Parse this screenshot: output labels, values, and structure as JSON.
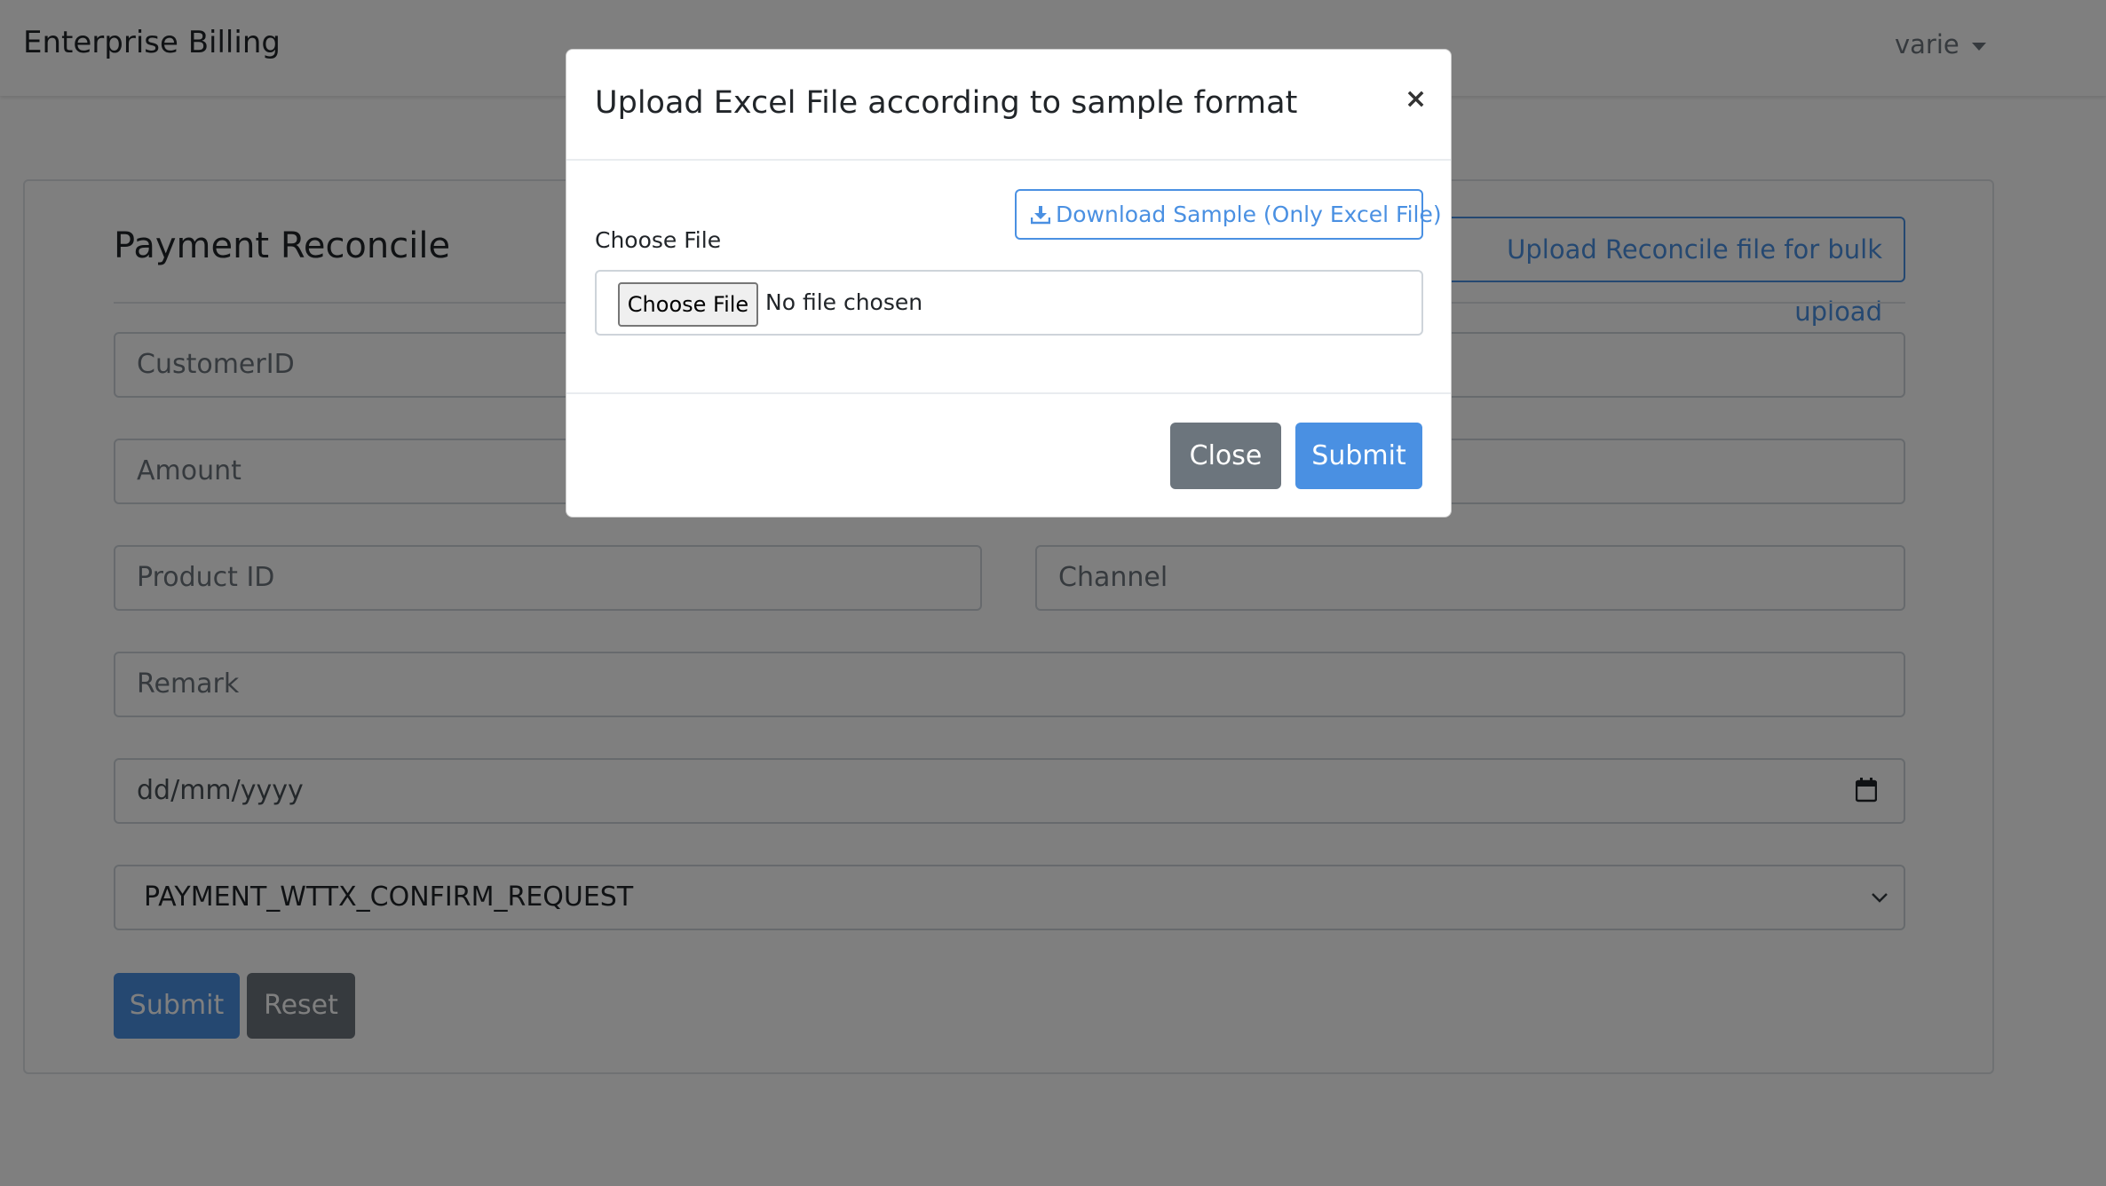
{
  "navbar": {
    "brand": "Enterprise Billing",
    "user": "varie"
  },
  "card": {
    "title": "Payment Reconcile",
    "bulk_upload_label": "Upload Reconcile file for bulk upload",
    "fields": {
      "customer_id": "CustomerID",
      "amount": "Amount",
      "product_id": "Product ID",
      "channel": "Channel",
      "remark": "Remark",
      "date": "dd/mm/yyyy"
    },
    "request_type": {
      "selected": "PAYMENT_WTTX_CONFIRM_REQUEST"
    },
    "submit_label": "Submit",
    "reset_label": "Reset"
  },
  "modal": {
    "title": "Upload Excel File according to sample format",
    "close_symbol": "×",
    "download_label": "Download Sample (Only Excel File)",
    "choose_file_label": "Choose File",
    "file_button_label": "Choose File",
    "file_status": "No file chosen",
    "close_label": "Close",
    "submit_label": "Submit"
  },
  "colors": {
    "primary": "#4a90e2",
    "secondary": "#6c757d",
    "backdrop": "rgba(0,0,0,0.5)"
  },
  "icons": {
    "download": "download-icon",
    "calendar": "calendar-icon",
    "select_arrow": "chevron-down-icon",
    "user_caret": "caret-down-icon",
    "close": "close-icon"
  }
}
